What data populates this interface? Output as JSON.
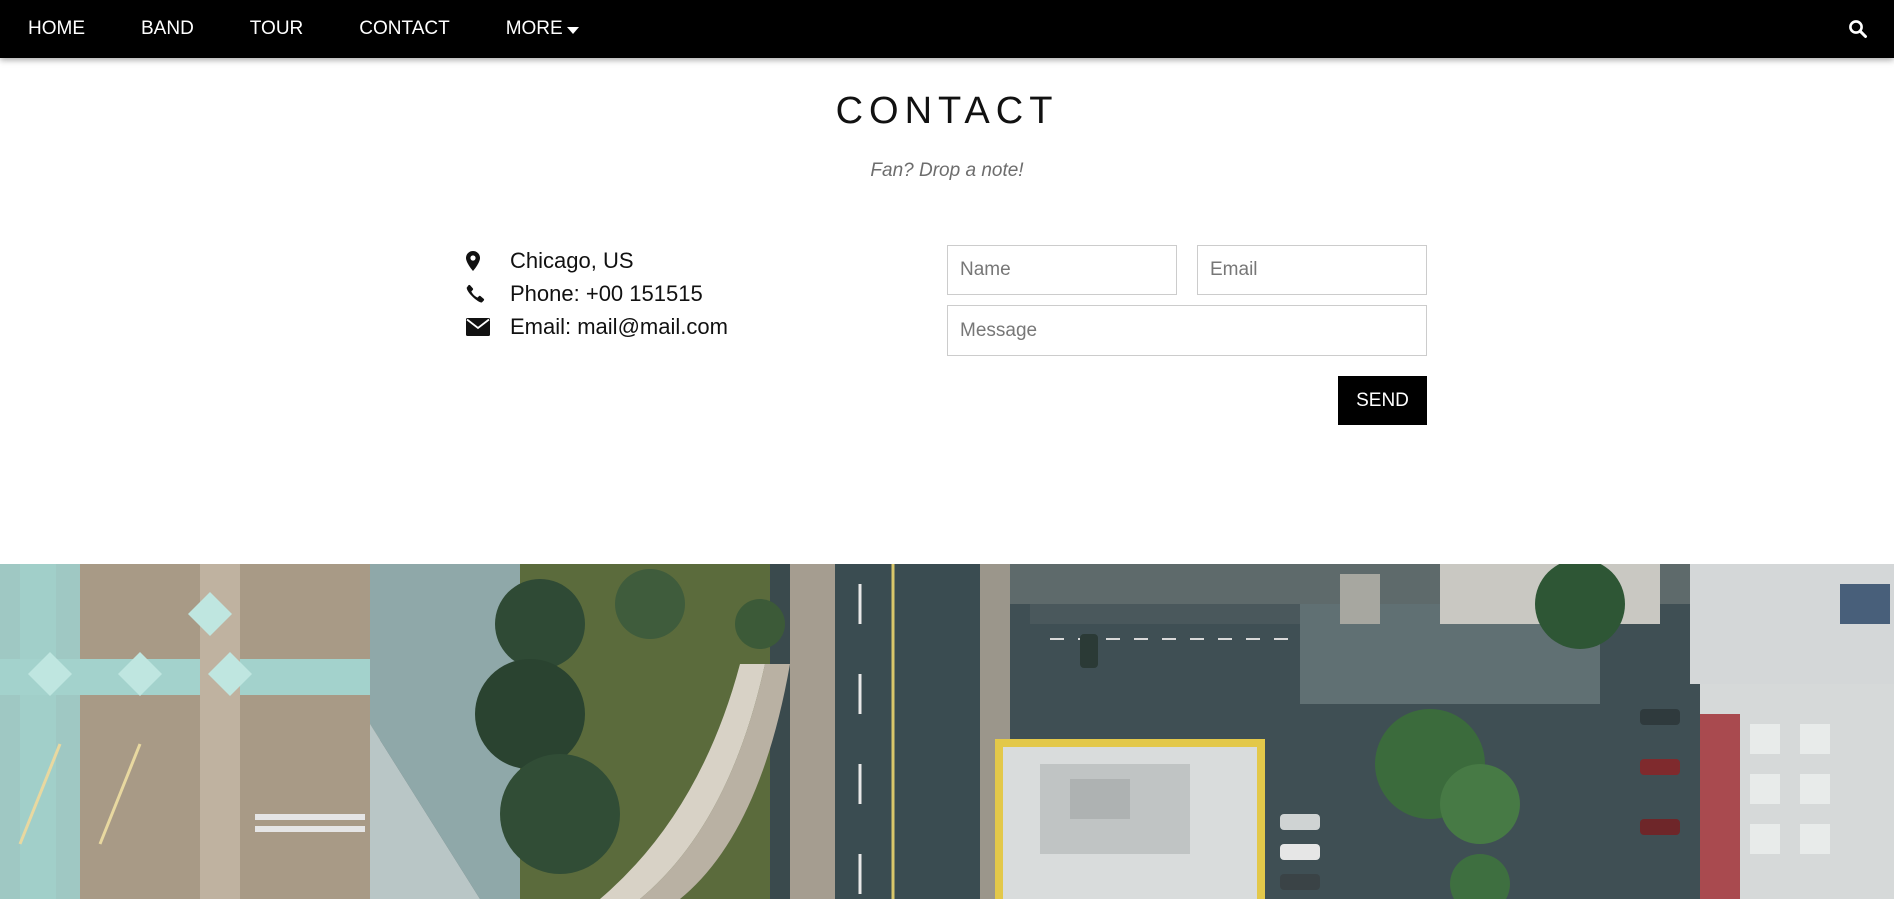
{
  "nav": {
    "items": [
      {
        "label": "HOME"
      },
      {
        "label": "BAND"
      },
      {
        "label": "TOUR"
      },
      {
        "label": "CONTACT"
      },
      {
        "label": "MORE"
      }
    ],
    "search_icon": "search-icon",
    "background": "#000000",
    "text_color": "#ffffff"
  },
  "contact": {
    "title": "CONTACT",
    "subtitle": "Fan? Drop a note!",
    "info": [
      {
        "icon": "map-marker-icon",
        "text": "Chicago, US"
      },
      {
        "icon": "phone-icon",
        "text": "Phone: +00 151515"
      },
      {
        "icon": "envelope-icon",
        "text": "Email: mail@mail.com"
      }
    ],
    "form": {
      "name_placeholder": "Name",
      "email_placeholder": "Email",
      "message_placeholder": "Message",
      "send_label": "SEND"
    }
  },
  "colors": {
    "accent": "#000000",
    "subtitle": "#6d6d6d",
    "input_border": "#cccccc"
  }
}
